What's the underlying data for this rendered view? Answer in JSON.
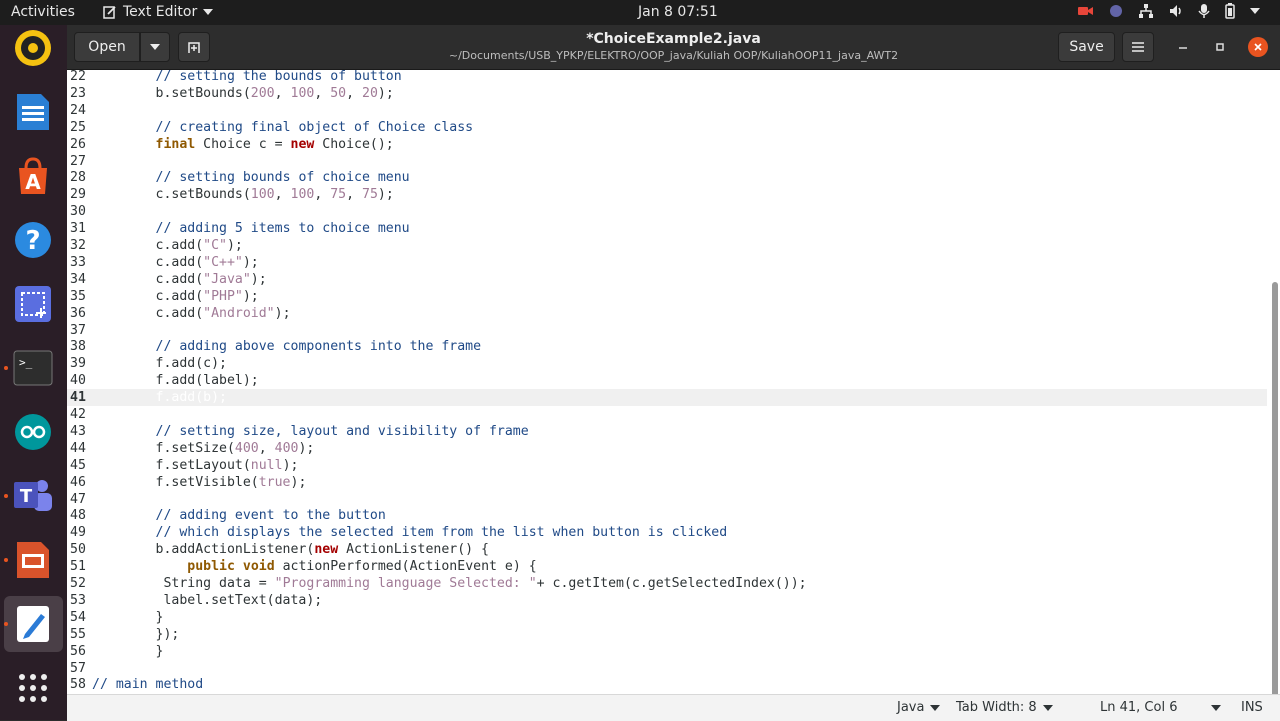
{
  "topbar": {
    "activities": "Activities",
    "app_name": "Text Editor",
    "clock": "Jan 8  07:51"
  },
  "header": {
    "open_label": "Open",
    "title": "*ChoiceExample2.java",
    "path": "~/Documents/USB_YPKP/ELEKTRO/OOP_java/Kuliah OOP/KuliahOOP11_java_AWT2",
    "save_label": "Save"
  },
  "editor": {
    "lines": [
      {
        "n": "22",
        "t": "        // setting the bounds of button"
      },
      {
        "n": "23",
        "t": "        b.setBounds(200, 100, 50, 20);"
      },
      {
        "n": "24",
        "t": ""
      },
      {
        "n": "25",
        "t": "        // creating final object of Choice class"
      },
      {
        "n": "26",
        "t": "        final Choice c = new Choice();"
      },
      {
        "n": "27",
        "t": ""
      },
      {
        "n": "28",
        "t": "        // setting bounds of choice menu"
      },
      {
        "n": "29",
        "t": "        c.setBounds(100, 100, 75, 75);"
      },
      {
        "n": "30",
        "t": ""
      },
      {
        "n": "31",
        "t": "        // adding 5 items to choice menu"
      },
      {
        "n": "32",
        "t": "        c.add(\"C\");"
      },
      {
        "n": "33",
        "t": "        c.add(\"C++\");"
      },
      {
        "n": "34",
        "t": "        c.add(\"Java\");"
      },
      {
        "n": "35",
        "t": "        c.add(\"PHP\");"
      },
      {
        "n": "36",
        "t": "        c.add(\"Android\");"
      },
      {
        "n": "37",
        "t": ""
      },
      {
        "n": "38",
        "t": "        // adding above components into the frame"
      },
      {
        "n": "39",
        "t": "        f.add(c);"
      },
      {
        "n": "40",
        "t": "        f.add(label);"
      },
      {
        "n": "41",
        "t": "        f.add(b);"
      },
      {
        "n": "42",
        "t": ""
      },
      {
        "n": "43",
        "t": "        // setting size, layout and visibility of frame"
      },
      {
        "n": "44",
        "t": "        f.setSize(400, 400);"
      },
      {
        "n": "45",
        "t": "        f.setLayout(null);"
      },
      {
        "n": "46",
        "t": "        f.setVisible(true);"
      },
      {
        "n": "47",
        "t": ""
      },
      {
        "n": "48",
        "t": "        // adding event to the button"
      },
      {
        "n": "49",
        "t": "        // which displays the selected item from the list when button is clicked"
      },
      {
        "n": "50",
        "t": "        b.addActionListener(new ActionListener() {"
      },
      {
        "n": "51",
        "t": "            public void actionPerformed(ActionEvent e) {"
      },
      {
        "n": "52",
        "t": "         String data = \"Programming language Selected: \"+ c.getItem(c.getSelectedIndex());"
      },
      {
        "n": "53",
        "t": "         label.setText(data);"
      },
      {
        "n": "54",
        "t": "        }"
      },
      {
        "n": "55",
        "t": "        });"
      },
      {
        "n": "56",
        "t": "        }"
      },
      {
        "n": "57",
        "t": ""
      },
      {
        "n": "58",
        "t": "// main method"
      }
    ],
    "current_line": "41"
  },
  "status": {
    "language": "Java",
    "tab_width": "Tab Width: 8",
    "position": "Ln 41, Col 6",
    "mode": "INS"
  },
  "dock": {
    "items": [
      "rhythmbox-icon",
      "writer-icon",
      "software-center-icon",
      "help-icon",
      "screenshot-icon",
      "terminal-icon",
      "arduino-icon",
      "teams-icon",
      "impress-icon",
      "text-editor-icon",
      "show-apps-icon"
    ]
  }
}
